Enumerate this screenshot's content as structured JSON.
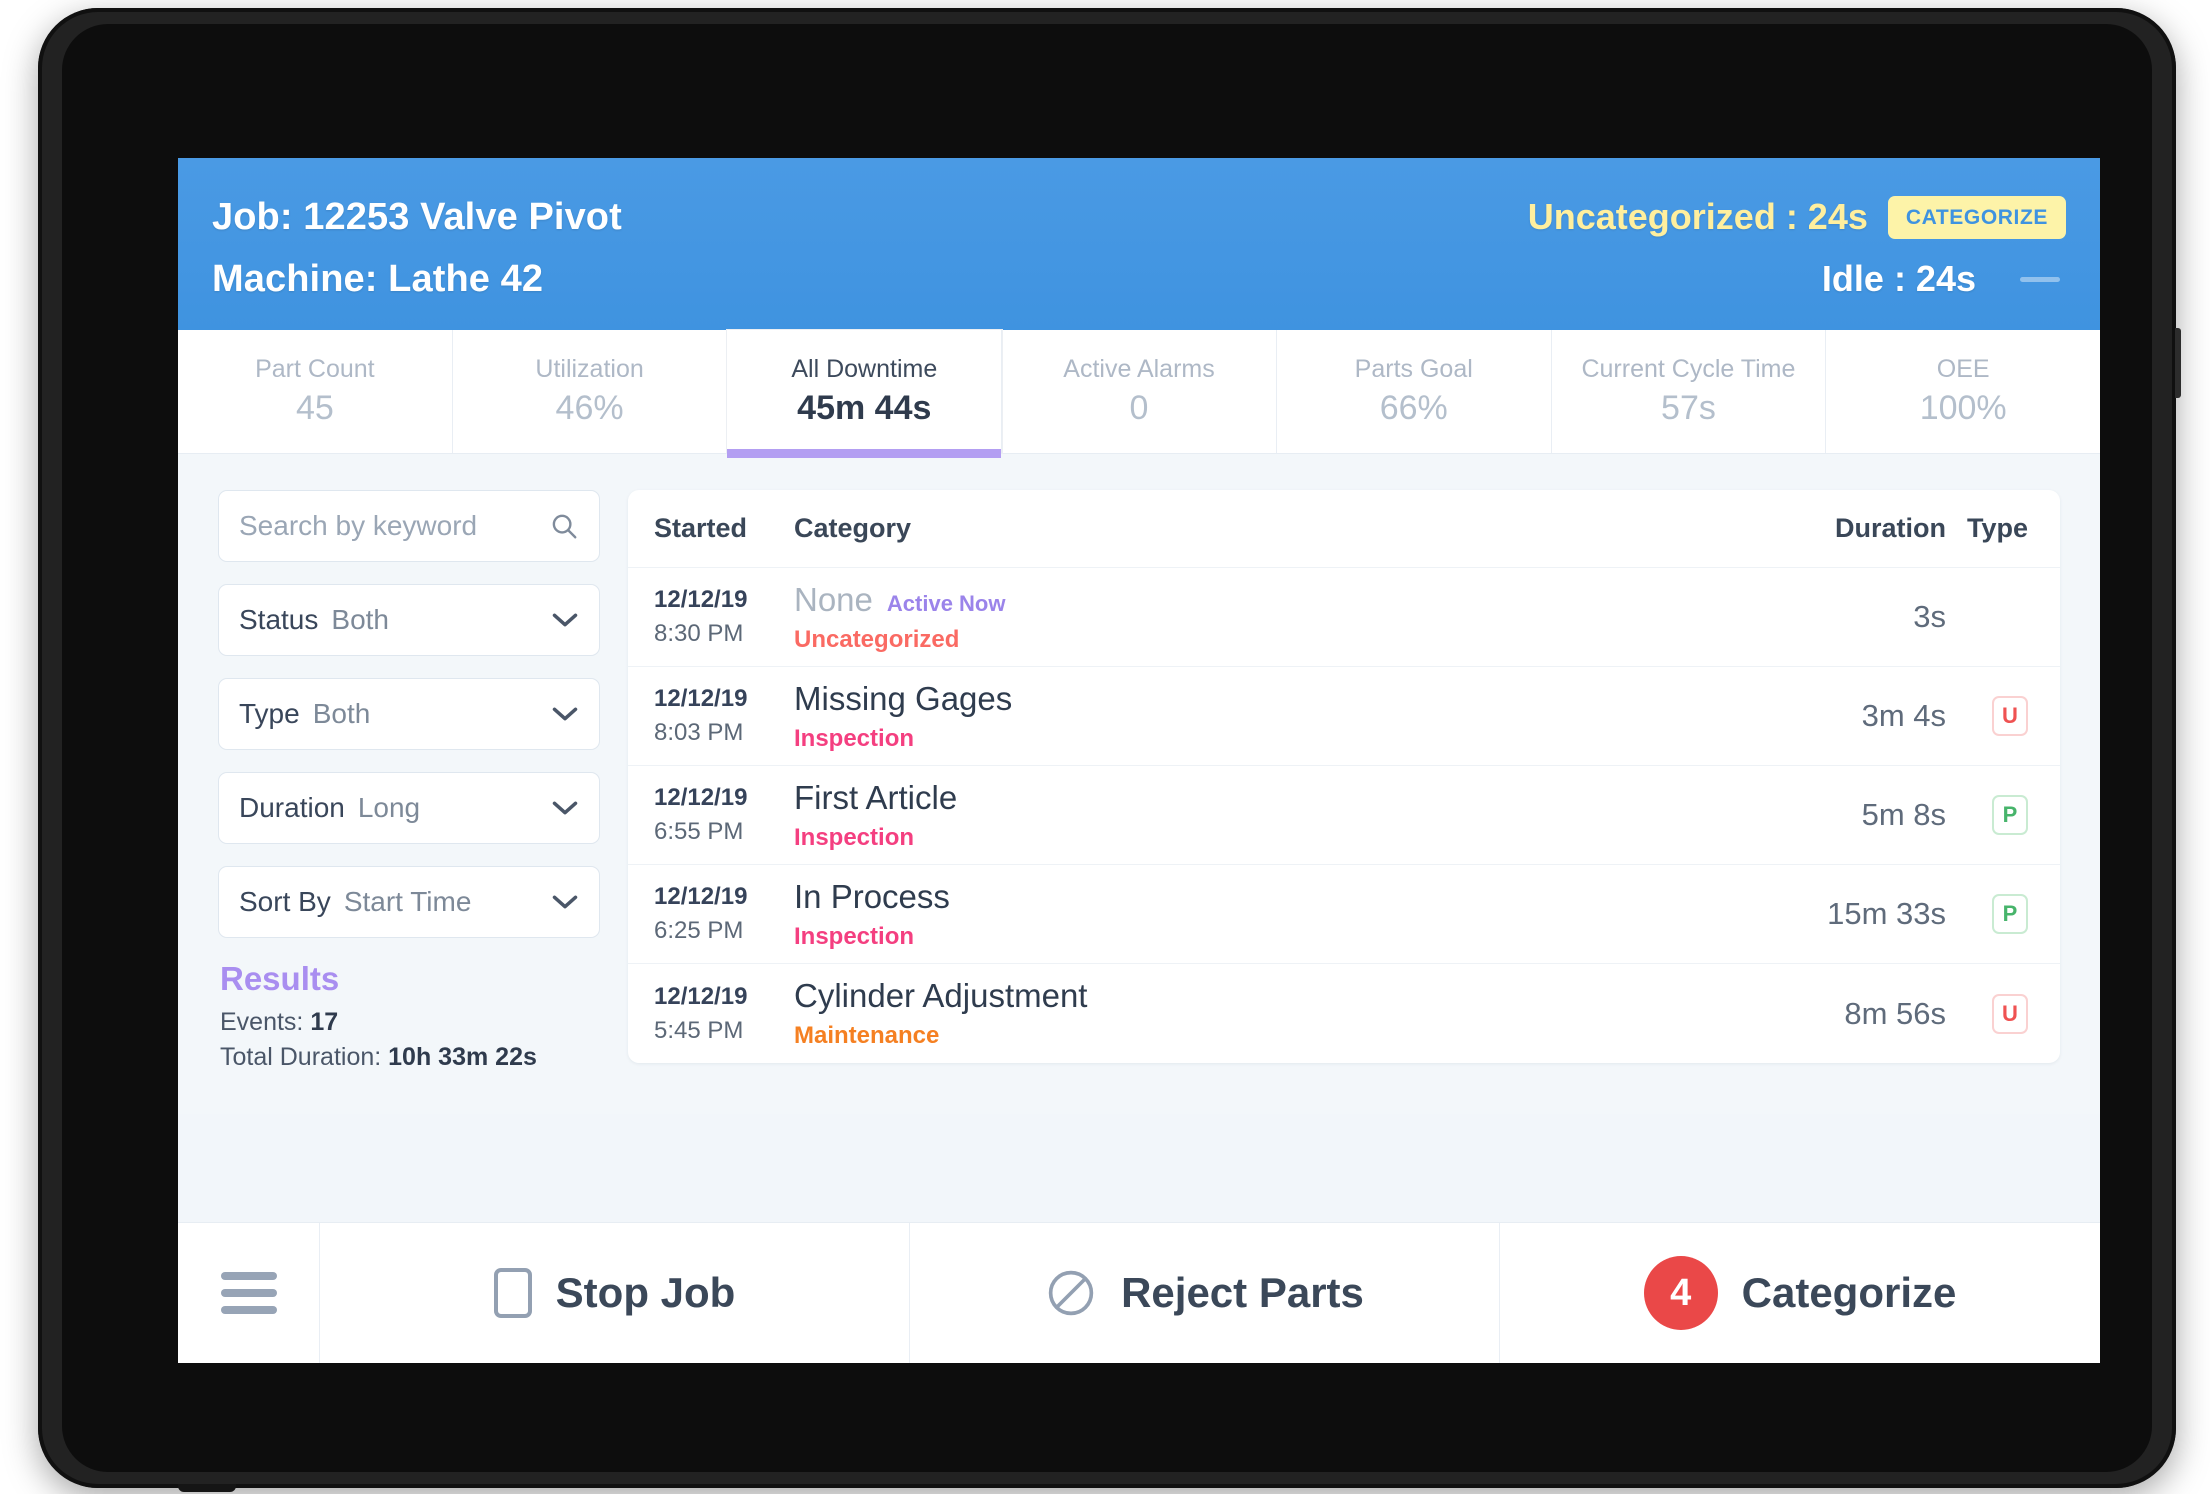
{
  "header": {
    "job_title": "Job: 12253 Valve Pivot",
    "machine_title": "Machine: Lathe 42",
    "uncategorized_text": "Uncategorized : 24s",
    "categorize_chip": "CATEGORIZE",
    "idle_text": "Idle : 24s",
    "accent_blue": "#3f93e0",
    "chip_yellow": "#fdf3a8"
  },
  "kpis": [
    {
      "label": "Part Count",
      "value": "45",
      "active": false
    },
    {
      "label": "Utilization",
      "value": "46%",
      "active": false
    },
    {
      "label": "All Downtime",
      "value": "45m 44s",
      "active": true
    },
    {
      "label": "Active Alarms",
      "value": "0",
      "active": false
    },
    {
      "label": "Parts Goal",
      "value": "66%",
      "active": false
    },
    {
      "label": "Current Cycle Time",
      "value": "57s",
      "active": false
    },
    {
      "label": "OEE",
      "value": "100%",
      "active": false
    }
  ],
  "filters": {
    "search_placeholder": "Search by keyword",
    "search_value": "",
    "status": {
      "label": "Status",
      "value": "Both"
    },
    "type": {
      "label": "Type",
      "value": "Both"
    },
    "duration": {
      "label": "Duration",
      "value": "Long"
    },
    "sort_by": {
      "label": "Sort By",
      "value": "Start Time"
    }
  },
  "results": {
    "title": "Results",
    "events_label": "Events:",
    "events_value": "17",
    "total_duration_label": "Total Duration:",
    "total_duration_value": "10h 33m 22s"
  },
  "table": {
    "columns": {
      "started": "Started",
      "category": "Category",
      "duration": "Duration",
      "type": "Type"
    },
    "rows": [
      {
        "date": "12/12/19",
        "time": "8:30 PM",
        "category": "None",
        "category_muted": true,
        "active_now": "Active Now",
        "sub": "Uncategorized",
        "sub_color": "#fa6a63",
        "duration": "3s",
        "type": "",
        "type_kind": "empty"
      },
      {
        "date": "12/12/19",
        "time": "8:03 PM",
        "category": "Missing Gages",
        "category_muted": false,
        "active_now": "",
        "sub": "Inspection",
        "sub_color": "#f43f80",
        "duration": "3m 4s",
        "type": "U",
        "type_kind": "u"
      },
      {
        "date": "12/12/19",
        "time": "6:55 PM",
        "category": "First Article",
        "category_muted": false,
        "active_now": "",
        "sub": "Inspection",
        "sub_color": "#f43f80",
        "duration": "5m 8s",
        "type": "P",
        "type_kind": "p"
      },
      {
        "date": "12/12/19",
        "time": "6:25 PM",
        "category": "In Process",
        "category_muted": false,
        "active_now": "",
        "sub": "Inspection",
        "sub_color": "#f43f80",
        "duration": "15m 33s",
        "type": "P",
        "type_kind": "p"
      },
      {
        "date": "12/12/19",
        "time": "5:45 PM",
        "category": "Cylinder Adjustment",
        "category_muted": false,
        "active_now": "",
        "sub": "Maintenance",
        "sub_color": "#f58022",
        "duration": "8m 56s",
        "type": "U",
        "type_kind": "u"
      }
    ]
  },
  "action_bar": {
    "stop_job": "Stop Job",
    "reject_parts": "Reject Parts",
    "categorize": "Categorize",
    "categorize_count": "4",
    "count_badge_color": "#ea4848"
  }
}
